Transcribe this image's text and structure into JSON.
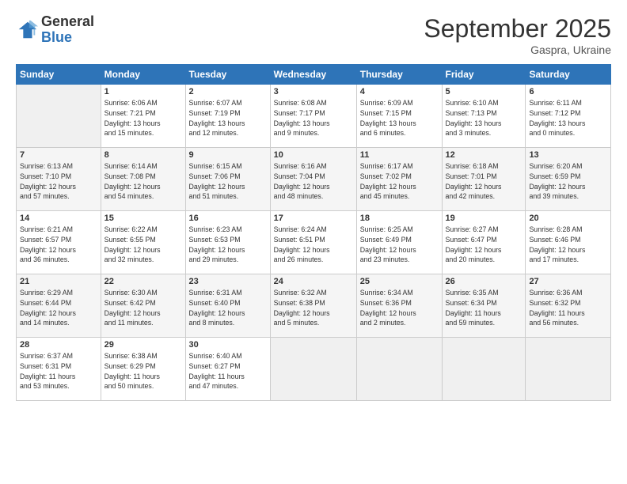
{
  "logo": {
    "general": "General",
    "blue": "Blue"
  },
  "title": "September 2025",
  "location": "Gaspra, Ukraine",
  "days_of_week": [
    "Sunday",
    "Monday",
    "Tuesday",
    "Wednesday",
    "Thursday",
    "Friday",
    "Saturday"
  ],
  "weeks": [
    [
      {
        "num": "",
        "info": ""
      },
      {
        "num": "1",
        "info": "Sunrise: 6:06 AM\nSunset: 7:21 PM\nDaylight: 13 hours\nand 15 minutes."
      },
      {
        "num": "2",
        "info": "Sunrise: 6:07 AM\nSunset: 7:19 PM\nDaylight: 13 hours\nand 12 minutes."
      },
      {
        "num": "3",
        "info": "Sunrise: 6:08 AM\nSunset: 7:17 PM\nDaylight: 13 hours\nand 9 minutes."
      },
      {
        "num": "4",
        "info": "Sunrise: 6:09 AM\nSunset: 7:15 PM\nDaylight: 13 hours\nand 6 minutes."
      },
      {
        "num": "5",
        "info": "Sunrise: 6:10 AM\nSunset: 7:13 PM\nDaylight: 13 hours\nand 3 minutes."
      },
      {
        "num": "6",
        "info": "Sunrise: 6:11 AM\nSunset: 7:12 PM\nDaylight: 13 hours\nand 0 minutes."
      }
    ],
    [
      {
        "num": "7",
        "info": "Sunrise: 6:13 AM\nSunset: 7:10 PM\nDaylight: 12 hours\nand 57 minutes."
      },
      {
        "num": "8",
        "info": "Sunrise: 6:14 AM\nSunset: 7:08 PM\nDaylight: 12 hours\nand 54 minutes."
      },
      {
        "num": "9",
        "info": "Sunrise: 6:15 AM\nSunset: 7:06 PM\nDaylight: 12 hours\nand 51 minutes."
      },
      {
        "num": "10",
        "info": "Sunrise: 6:16 AM\nSunset: 7:04 PM\nDaylight: 12 hours\nand 48 minutes."
      },
      {
        "num": "11",
        "info": "Sunrise: 6:17 AM\nSunset: 7:02 PM\nDaylight: 12 hours\nand 45 minutes."
      },
      {
        "num": "12",
        "info": "Sunrise: 6:18 AM\nSunset: 7:01 PM\nDaylight: 12 hours\nand 42 minutes."
      },
      {
        "num": "13",
        "info": "Sunrise: 6:20 AM\nSunset: 6:59 PM\nDaylight: 12 hours\nand 39 minutes."
      }
    ],
    [
      {
        "num": "14",
        "info": "Sunrise: 6:21 AM\nSunset: 6:57 PM\nDaylight: 12 hours\nand 36 minutes."
      },
      {
        "num": "15",
        "info": "Sunrise: 6:22 AM\nSunset: 6:55 PM\nDaylight: 12 hours\nand 32 minutes."
      },
      {
        "num": "16",
        "info": "Sunrise: 6:23 AM\nSunset: 6:53 PM\nDaylight: 12 hours\nand 29 minutes."
      },
      {
        "num": "17",
        "info": "Sunrise: 6:24 AM\nSunset: 6:51 PM\nDaylight: 12 hours\nand 26 minutes."
      },
      {
        "num": "18",
        "info": "Sunrise: 6:25 AM\nSunset: 6:49 PM\nDaylight: 12 hours\nand 23 minutes."
      },
      {
        "num": "19",
        "info": "Sunrise: 6:27 AM\nSunset: 6:47 PM\nDaylight: 12 hours\nand 20 minutes."
      },
      {
        "num": "20",
        "info": "Sunrise: 6:28 AM\nSunset: 6:46 PM\nDaylight: 12 hours\nand 17 minutes."
      }
    ],
    [
      {
        "num": "21",
        "info": "Sunrise: 6:29 AM\nSunset: 6:44 PM\nDaylight: 12 hours\nand 14 minutes."
      },
      {
        "num": "22",
        "info": "Sunrise: 6:30 AM\nSunset: 6:42 PM\nDaylight: 12 hours\nand 11 minutes."
      },
      {
        "num": "23",
        "info": "Sunrise: 6:31 AM\nSunset: 6:40 PM\nDaylight: 12 hours\nand 8 minutes."
      },
      {
        "num": "24",
        "info": "Sunrise: 6:32 AM\nSunset: 6:38 PM\nDaylight: 12 hours\nand 5 minutes."
      },
      {
        "num": "25",
        "info": "Sunrise: 6:34 AM\nSunset: 6:36 PM\nDaylight: 12 hours\nand 2 minutes."
      },
      {
        "num": "26",
        "info": "Sunrise: 6:35 AM\nSunset: 6:34 PM\nDaylight: 11 hours\nand 59 minutes."
      },
      {
        "num": "27",
        "info": "Sunrise: 6:36 AM\nSunset: 6:32 PM\nDaylight: 11 hours\nand 56 minutes."
      }
    ],
    [
      {
        "num": "28",
        "info": "Sunrise: 6:37 AM\nSunset: 6:31 PM\nDaylight: 11 hours\nand 53 minutes."
      },
      {
        "num": "29",
        "info": "Sunrise: 6:38 AM\nSunset: 6:29 PM\nDaylight: 11 hours\nand 50 minutes."
      },
      {
        "num": "30",
        "info": "Sunrise: 6:40 AM\nSunset: 6:27 PM\nDaylight: 11 hours\nand 47 minutes."
      },
      {
        "num": "",
        "info": ""
      },
      {
        "num": "",
        "info": ""
      },
      {
        "num": "",
        "info": ""
      },
      {
        "num": "",
        "info": ""
      }
    ]
  ]
}
